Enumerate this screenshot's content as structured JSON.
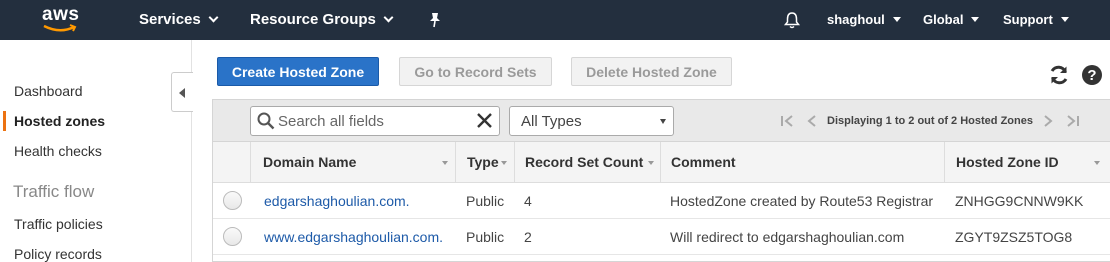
{
  "nav": {
    "logo": "aws",
    "services": "Services",
    "resource_groups": "Resource Groups",
    "user": "shaghoul",
    "region": "Global",
    "support": "Support"
  },
  "sidebar": {
    "items": [
      {
        "label": "Dashboard"
      },
      {
        "label": "Hosted zones",
        "active": true
      },
      {
        "label": "Health checks"
      }
    ],
    "section": "Traffic flow",
    "section_items": [
      {
        "label": "Traffic policies"
      },
      {
        "label": "Policy records"
      }
    ]
  },
  "toolbar": {
    "create": "Create Hosted Zone",
    "goto": "Go to Record Sets",
    "delete": "Delete Hosted Zone"
  },
  "filter": {
    "search_placeholder": "Search all fields",
    "type_select": "All Types",
    "pager_text": "Displaying 1 to 2 out of 2 Hosted Zones"
  },
  "table": {
    "columns": [
      "Domain Name",
      "Type",
      "Record Set Count",
      "Comment",
      "Hosted Zone ID"
    ],
    "rows": [
      {
        "domain": "edgarshaghoulian.com.",
        "type": "Public",
        "count": "4",
        "comment": "HostedZone created by Route53 Registrar",
        "zone_id": "ZNHGG9CNNW9KK"
      },
      {
        "domain": "www.edgarshaghoulian.com.",
        "type": "Public",
        "count": "2",
        "comment": "Will redirect to edgarshaghoulian.com",
        "zone_id": "ZGYT9ZSZ5TOG8"
      }
    ]
  },
  "colors": {
    "nav_bg": "#232f3e",
    "primary": "#2a73c8",
    "active_bar": "#ec7211",
    "link": "#1d5aa8"
  }
}
